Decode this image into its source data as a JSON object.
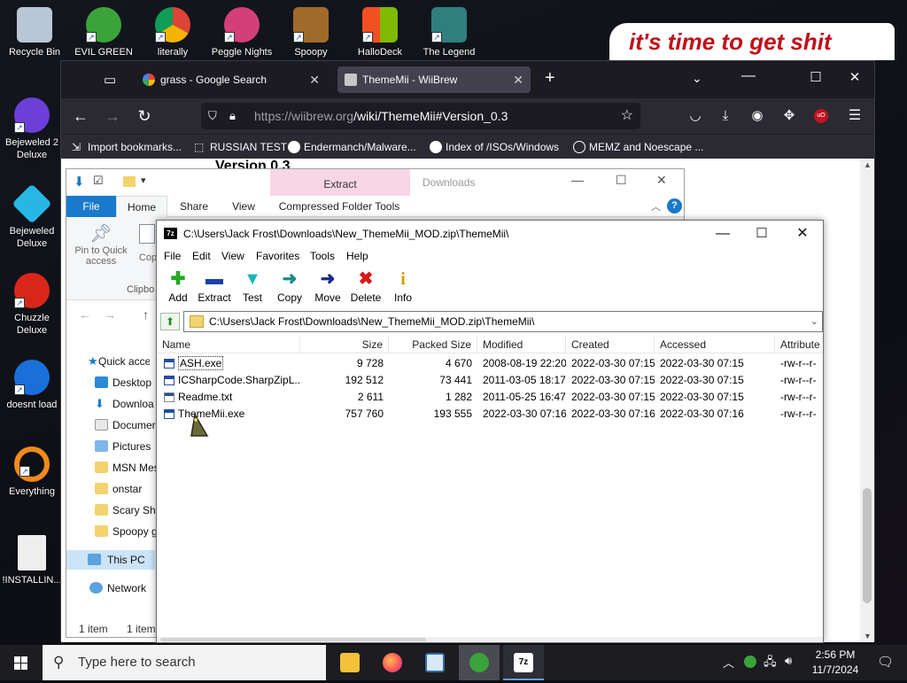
{
  "desktop": {
    "banner_text": "it's time to get shit",
    "icons": [
      {
        "label": "Recycle Bin",
        "color": "#b9c6d6"
      },
      {
        "label": "EVIL GREEN",
        "color": "#3aa33a"
      },
      {
        "label": "literally",
        "color": "#4285f4"
      },
      {
        "label": "Peggle Nights",
        "color": "#d43f7a"
      },
      {
        "label": "Spoopy",
        "color": "#a06a2a"
      },
      {
        "label": "HalloDeck",
        "color": "#f25022"
      },
      {
        "label": "The Legend",
        "color": "#2f7f7f"
      },
      {
        "label": "Bejeweled 2 Deluxe",
        "color": "#6b3fd8"
      },
      {
        "label": "Bejeweled Deluxe",
        "color": "#27b7e6"
      },
      {
        "label": "Chuzzle Deluxe",
        "color": "#d8261a"
      },
      {
        "label": "doesnt load",
        "color": "#1a6fd8"
      },
      {
        "label": "Everything",
        "color": "#f08a1c"
      },
      {
        "label": "!INSTALLIN...",
        "color": "#eeeeee"
      }
    ]
  },
  "browser": {
    "tabs": [
      {
        "label": "grass - Google Search"
      },
      {
        "label": "ThemeMii - WiiBrew"
      }
    ],
    "url_host": "https://wiibrew.org",
    "url_path": "/wiki/ThemeMii#Version_0.3",
    "bookmarks": [
      "Import bookmarks...",
      "RUSSIAN TEST",
      "Endermanch/Malware...",
      "Index of /ISOs/Windows",
      "MEMZ and Noescape ..."
    ],
    "page_heading": "Version 0.3"
  },
  "explorer": {
    "context_tab": "Extract",
    "context_title": "Downloads",
    "tabs": [
      "File",
      "Home",
      "Share",
      "View",
      "Compressed Folder Tools"
    ],
    "pin_label": "Pin to Quick access",
    "copy_label": "Cop",
    "group_label": "Clipbo",
    "nav_items": [
      "Quick acce",
      "Desktop",
      "Downloa",
      "Documer",
      "Pictures",
      "MSN Mes",
      "onstar",
      "Scary Shi",
      "Spoopy g",
      "This PC",
      "Network"
    ],
    "status_left": "1 item",
    "status_right": "1 item"
  },
  "sevenzip": {
    "title": "C:\\Users\\Jack Frost\\Downloads\\New_ThemeMii_MOD.zip\\ThemeMii\\",
    "icon_text": "7z",
    "menu": [
      "File",
      "Edit",
      "View",
      "Favorites",
      "Tools",
      "Help"
    ],
    "toolbar": [
      {
        "label": "Add",
        "glyph": "✚",
        "color": "#22aa22"
      },
      {
        "label": "Extract",
        "glyph": "▬",
        "color": "#1a3fb0"
      },
      {
        "label": "Test",
        "glyph": "▼",
        "color": "#19b6b6"
      },
      {
        "label": "Copy",
        "glyph": "➜",
        "color": "#1a8a8a"
      },
      {
        "label": "Move",
        "glyph": "➜",
        "color": "#1a2a8a"
      },
      {
        "label": "Delete",
        "glyph": "✖",
        "color": "#d81818"
      },
      {
        "label": "Info",
        "glyph": "i",
        "color": "#c9a200"
      }
    ],
    "address": "C:\\Users\\Jack Frost\\Downloads\\New_ThemeMii_MOD.zip\\ThemeMii\\",
    "columns": [
      "Name",
      "Size",
      "Packed Size",
      "Modified",
      "Created",
      "Accessed",
      "Attribute"
    ],
    "rows": [
      {
        "name": "ASH.exe",
        "size": "9 728",
        "packed": "4 670",
        "modified": "2008-08-19 22:20",
        "created": "2022-03-30 07:15",
        "accessed": "2022-03-30 07:15",
        "attr": "-rw-r--r-"
      },
      {
        "name": "ICSharpCode.SharpZipL...",
        "size": "192 512",
        "packed": "73 441",
        "modified": "2011-03-05 18:17",
        "created": "2022-03-30 07:15",
        "accessed": "2022-03-30 07:15",
        "attr": "-rw-r--r-"
      },
      {
        "name": "Readme.txt",
        "size": "2 611",
        "packed": "1 282",
        "modified": "2011-05-25 16:47",
        "created": "2022-03-30 07:15",
        "accessed": "2022-03-30 07:15",
        "attr": "-rw-r--r-"
      },
      {
        "name": "ThemeMii.exe",
        "size": "757 760",
        "packed": "193 555",
        "modified": "2022-03-30 07:16",
        "created": "2022-03-30 07:16",
        "accessed": "2022-03-30 07:16",
        "attr": "-rw-r--r-"
      }
    ]
  },
  "taskbar": {
    "search_placeholder": "Type here to search",
    "time": "2:56 PM",
    "date": "11/7/2024"
  }
}
